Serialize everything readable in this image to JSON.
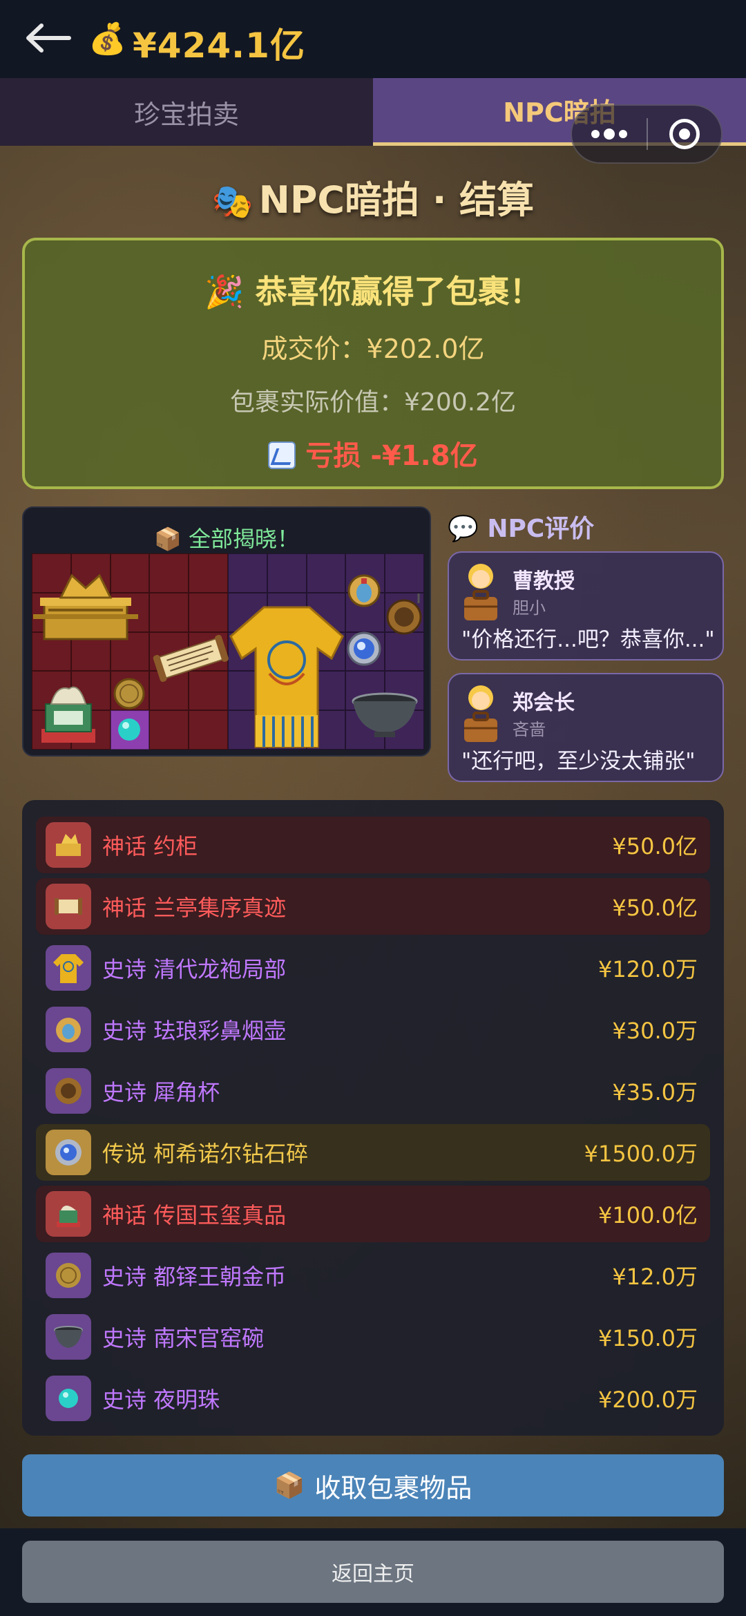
{
  "header": {
    "money_icon": "money-bag-icon",
    "money": "¥424.1亿"
  },
  "tabs": [
    {
      "label": "珍宝拍卖",
      "active": false
    },
    {
      "label": "NPC暗拍",
      "active": true
    }
  ],
  "heading": {
    "icon": "theater-masks-icon",
    "text": "NPC暗拍 · 结算"
  },
  "result": {
    "title": "恭喜你赢得了包裹！",
    "title_icon": "party-popper-icon",
    "deal_price": "成交价：¥202.0亿",
    "actual_value": "包裹实际价值：¥200.2亿",
    "loss": "亏损 -¥1.8亿",
    "loss_icon": "chart-down-icon"
  },
  "reveal": {
    "icon": "package-icon",
    "title": "全部揭晓！"
  },
  "npc_section": {
    "icon": "speech-bubble-icon",
    "title": "NPC评价"
  },
  "npc_comments": [
    {
      "name": "曹教授",
      "trait": "胆小",
      "quote": "\"价格还行...吧？恭喜你...\""
    },
    {
      "name": "郑会长",
      "trait": "吝啬",
      "quote": "\"还行吧，至少没太铺张\""
    }
  ],
  "items": [
    {
      "label": "神话 约柜",
      "price": "¥50.0亿",
      "rarity": "myth"
    },
    {
      "label": "神话 兰亭集序真迹",
      "price": "¥50.0亿",
      "rarity": "myth"
    },
    {
      "label": "史诗 清代龙袍局部",
      "price": "¥120.0万",
      "rarity": "epic"
    },
    {
      "label": "史诗 珐琅彩鼻烟壶",
      "price": "¥30.0万",
      "rarity": "epic"
    },
    {
      "label": "史诗 犀角杯",
      "price": "¥35.0万",
      "rarity": "epic"
    },
    {
      "label": "传说 柯希诺尔钻石碎",
      "price": "¥1500.0万",
      "rarity": "legend"
    },
    {
      "label": "神话 传国玉玺真品",
      "price": "¥100.0亿",
      "rarity": "myth"
    },
    {
      "label": "史诗 都铎王朝金币",
      "price": "¥12.0万",
      "rarity": "epic"
    },
    {
      "label": "史诗 南宋官窑碗",
      "price": "¥150.0万",
      "rarity": "epic"
    },
    {
      "label": "史诗 夜明珠",
      "price": "¥200.0万",
      "rarity": "epic"
    }
  ],
  "buttons": {
    "collect": "收取包裹物品",
    "collect_icon": "package-icon",
    "home": "返回主页"
  },
  "colors": {
    "gold": "#f5c542",
    "myth": "#ff5b5b",
    "epic": "#c078ff",
    "legend": "#f2c94c",
    "accent_tab": "#5a4683"
  }
}
